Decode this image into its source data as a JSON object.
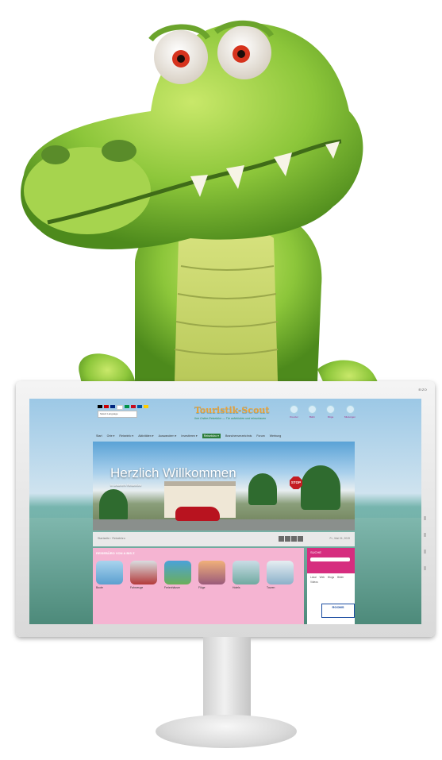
{
  "monitor": {
    "brand": "EIZO"
  },
  "website": {
    "language_select": "Select Language",
    "logo": "Touristik-Scout",
    "slogan": "Ihre Online-Reisebüro — Tür aufdrücken und reinschauen",
    "top_icons": [
      {
        "label": "Kreuzer",
        "icon": "cruise-icon"
      },
      {
        "label": "Bahn",
        "icon": "train-icon"
      },
      {
        "label": "Flüge",
        "icon": "plane-icon"
      },
      {
        "label": "Mietungen",
        "icon": "car-icon"
      }
    ],
    "nav": [
      {
        "label": "Start"
      },
      {
        "label": "Orte ▾"
      },
      {
        "label": "Reiseinfo ▾"
      },
      {
        "label": "Aktivitäten ▾"
      },
      {
        "label": "Auswandern ▾"
      },
      {
        "label": "Investieren ▾"
      },
      {
        "label": "Reisebüro ▾",
        "active": true
      },
      {
        "label": "Branchenverzeichnis"
      },
      {
        "label": "Forum"
      },
      {
        "label": "Werbung"
      }
    ],
    "hero": {
      "title": "Herzlich Willkommen",
      "subtitle": "in unserem Reisebüro",
      "sign": "STOP"
    },
    "breadcrumb": "Startseite › Reisebüro",
    "date": "Fr., Mai 24, 2019",
    "section_header": "REISEBÜRO VON A BIS Z",
    "thumbs": [
      {
        "label": "Boote",
        "color": "#5b9fcf"
      },
      {
        "label": "Fahrzeuge",
        "color": "#b33a3a"
      },
      {
        "label": "Ferienhäuser",
        "color": "#4aa2d8"
      },
      {
        "label": "Flüge",
        "color": "#d98a6a"
      },
      {
        "label": "Hotels",
        "color": "#6fa9a0"
      },
      {
        "label": "Touren",
        "color": "#8bb0c9"
      }
    ],
    "search": {
      "title": "SUCHE",
      "options": [
        "Lokal",
        "Web",
        "Blogs",
        "Bilder",
        "Videos"
      ],
      "banner": "ROOMS"
    }
  }
}
